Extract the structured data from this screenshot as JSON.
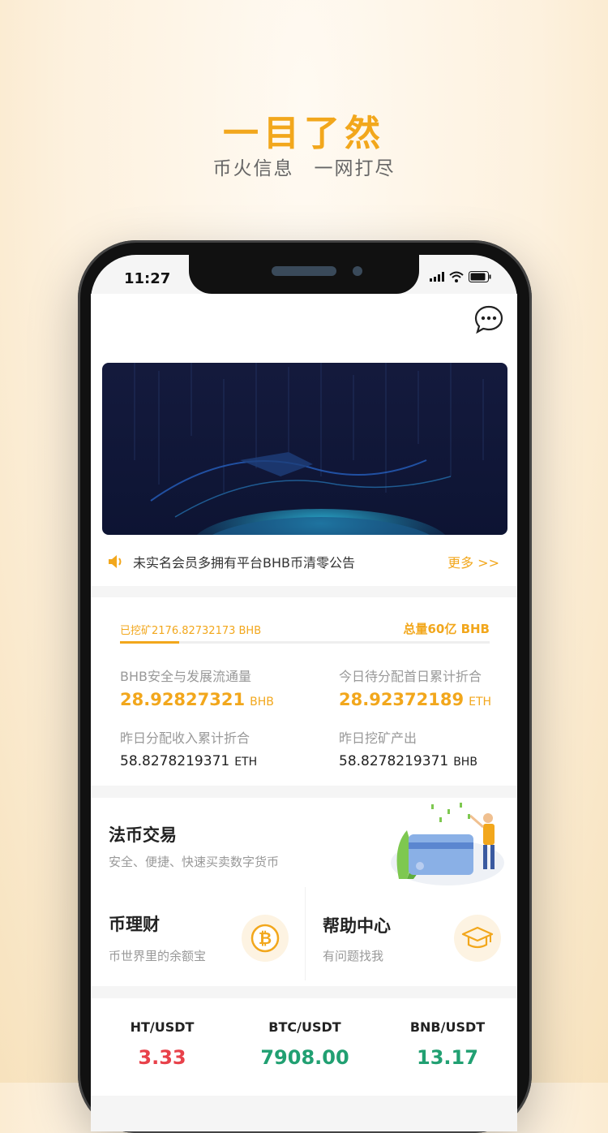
{
  "promo": {
    "title": "一目了然",
    "subtitle": "币火信息　一网打尽"
  },
  "status_bar": {
    "time": "11:27"
  },
  "notice": {
    "text": "未实名会员多拥有平台BHB币清零公告",
    "more": "更多 >>"
  },
  "mining": {
    "mined": "已挖矿2176.82732173 BHB",
    "total": "总量60亿 BHB",
    "progress": 0.16
  },
  "stats": [
    {
      "label": "BHB安全与发展流通量",
      "value": "28.92827321",
      "unit": "BHB"
    },
    {
      "label": "今日待分配首日累计折合",
      "value": "28.92372189",
      "unit": "ETH"
    },
    {
      "label": "昨日分配收入累计折合",
      "value": "58.8278219371",
      "unit": "ETH"
    },
    {
      "label": "昨日挖矿产出",
      "value": "58.8278219371",
      "unit": "BHB"
    }
  ],
  "services": {
    "fiat": {
      "title": "法币交易",
      "desc": "安全、便捷、快速买卖数字货币"
    },
    "wealth": {
      "title": "币理财",
      "desc": "币世界里的余额宝"
    },
    "help": {
      "title": "帮助中心",
      "desc": "有问题找我"
    }
  },
  "market": [
    {
      "pair": "HT/USDT",
      "price": "3.33",
      "color": "#e8414a"
    },
    {
      "pair": "BTC/USDT",
      "price": "7908.00",
      "color": "#21a072"
    },
    {
      "pair": "BNB/USDT",
      "price": "13.17",
      "color": "#21a072"
    }
  ],
  "colors": {
    "accent": "#f2a71c",
    "up": "#21a072",
    "down": "#e8414a"
  },
  "icons": [
    "chat-icon",
    "speaker-icon",
    "bitcoin-icon",
    "graduation-cap-icon",
    "signal-icon",
    "wifi-icon",
    "battery-icon"
  ]
}
